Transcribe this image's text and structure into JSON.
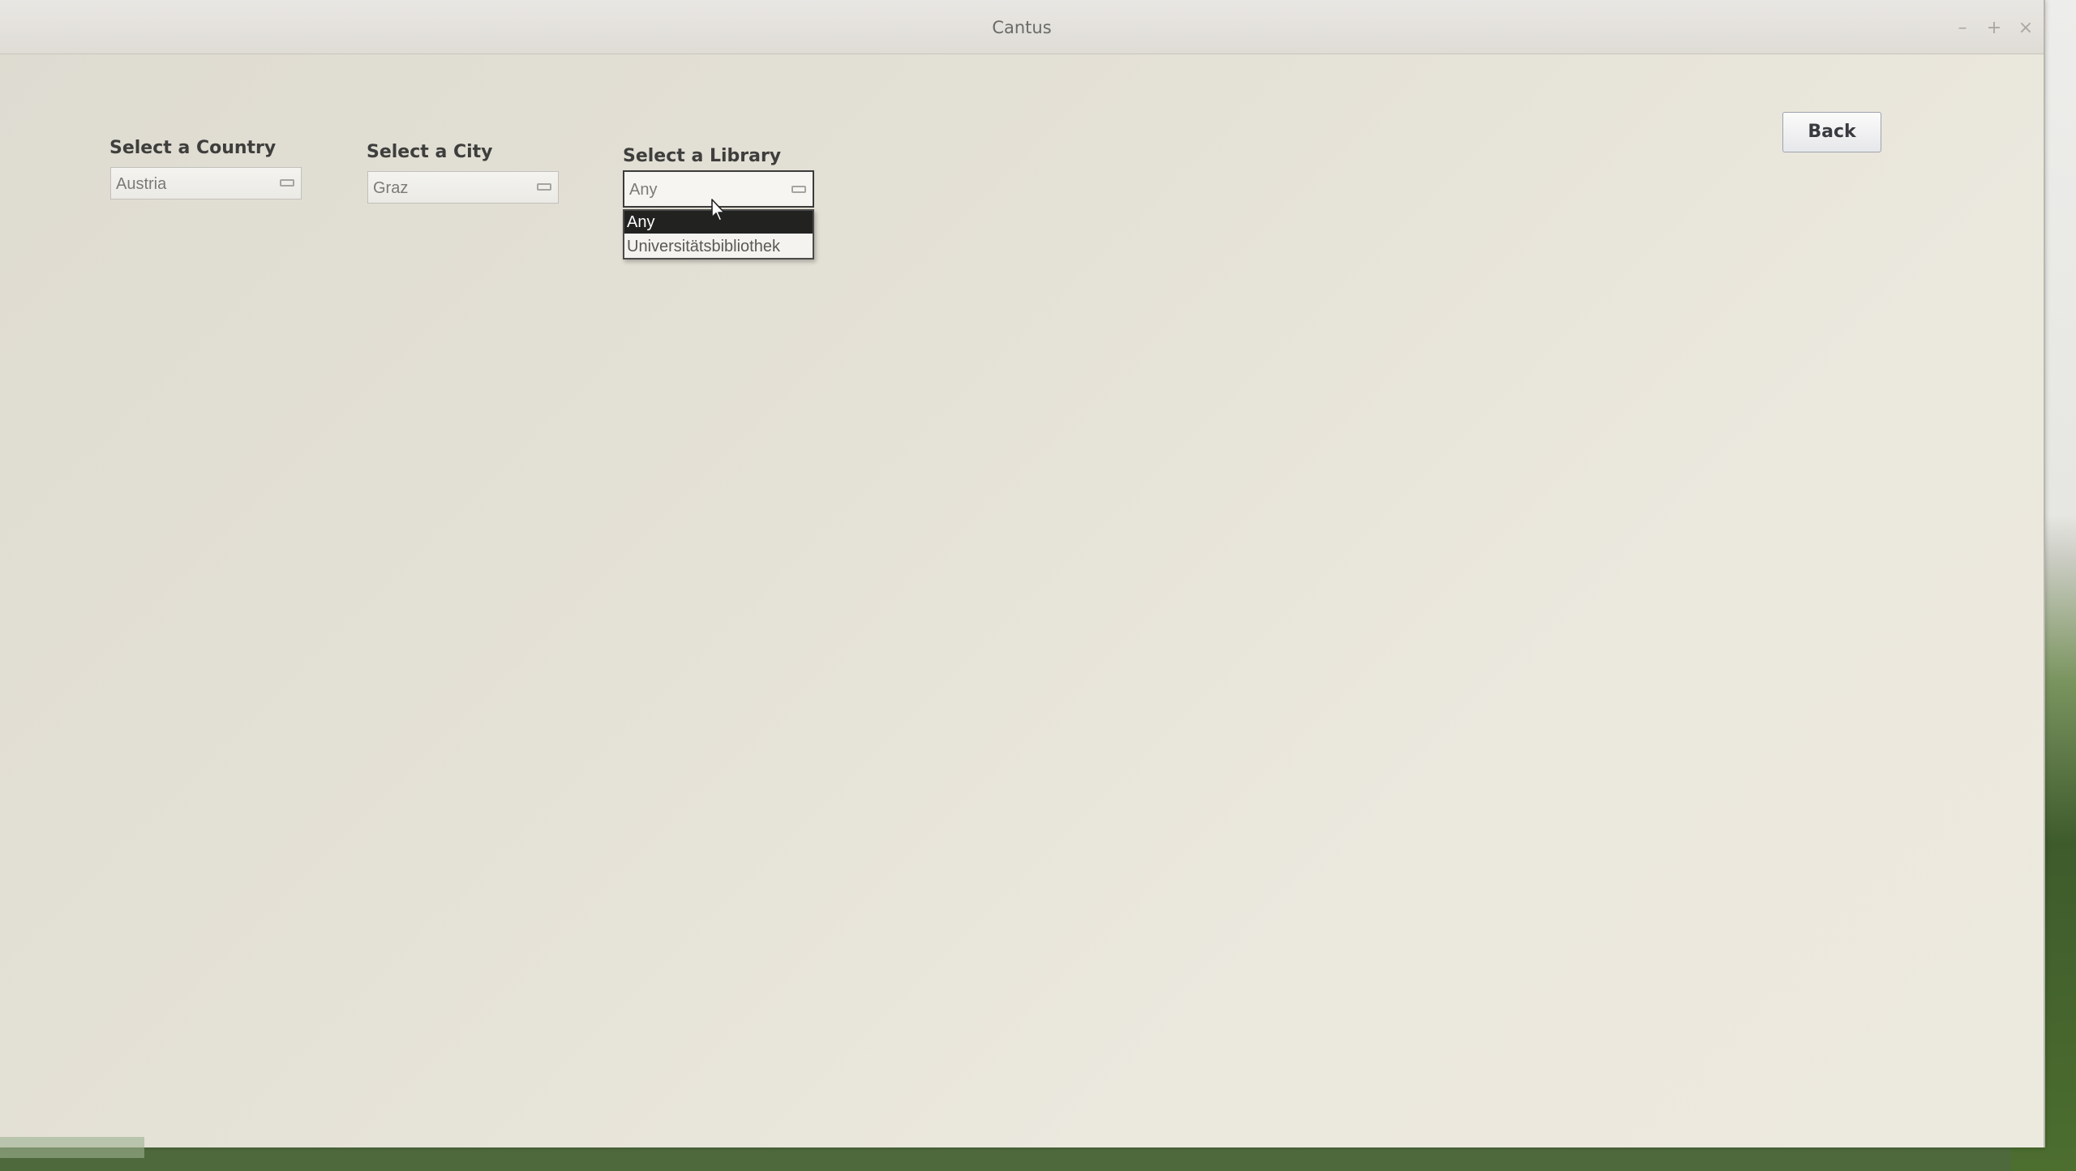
{
  "window": {
    "title": "Cantus",
    "controls": {
      "minimize": "–",
      "maximize": "+",
      "close": "×"
    }
  },
  "filters": {
    "country": {
      "label": "Select a Country",
      "value": "Austria"
    },
    "city": {
      "label": "Select a City",
      "value": "Graz"
    },
    "library": {
      "label": "Select a Library",
      "value": "Any",
      "options": [
        "Any",
        "Universitätsbibliothek"
      ],
      "selected_index": 0,
      "expanded": true
    }
  },
  "actions": {
    "back_label": "Back"
  },
  "icons": {
    "dropdown_arrow": "combo-arrow-icon",
    "pointer": "mouse-pointer-icon"
  },
  "colors": {
    "window_bg": "#e8e5db",
    "selected_option_bg": "#222221",
    "selected_option_fg": "#ffffff"
  }
}
